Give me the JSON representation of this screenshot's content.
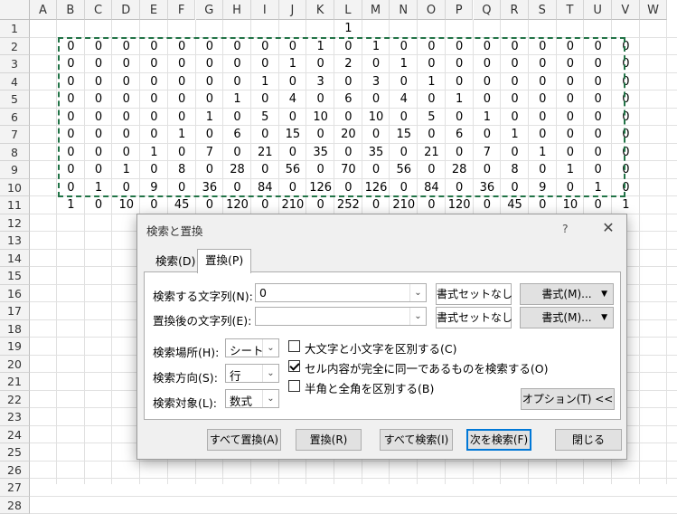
{
  "columns": [
    "A",
    "B",
    "C",
    "D",
    "E",
    "F",
    "G",
    "H",
    "I",
    "J",
    "K",
    "L",
    "M",
    "N",
    "O",
    "P",
    "Q",
    "R",
    "S",
    "T",
    "U",
    "V",
    "W"
  ],
  "rows": [
    "1",
    "2",
    "3",
    "4",
    "5",
    "6",
    "7",
    "8",
    "9",
    "10",
    "11",
    "12",
    "13",
    "14",
    "15",
    "16",
    "17",
    "18",
    "19",
    "20",
    "21",
    "22",
    "23",
    "24",
    "25",
    "26",
    "27",
    "28"
  ],
  "cells": {
    "row1": {
      "L": "1"
    },
    "data_columns": [
      "B",
      "C",
      "D",
      "E",
      "F",
      "G",
      "H",
      "I",
      "J",
      "K",
      "L",
      "M",
      "N",
      "O",
      "P",
      "Q",
      "R",
      "S",
      "T",
      "U",
      "V"
    ],
    "data_rows": [
      [
        "0",
        "0",
        "0",
        "0",
        "0",
        "0",
        "0",
        "0",
        "0",
        "1",
        "0",
        "1",
        "0",
        "0",
        "0",
        "0",
        "0",
        "0",
        "0",
        "0",
        "0"
      ],
      [
        "0",
        "0",
        "0",
        "0",
        "0",
        "0",
        "0",
        "0",
        "1",
        "0",
        "2",
        "0",
        "1",
        "0",
        "0",
        "0",
        "0",
        "0",
        "0",
        "0",
        "0"
      ],
      [
        "0",
        "0",
        "0",
        "0",
        "0",
        "0",
        "0",
        "1",
        "0",
        "3",
        "0",
        "3",
        "0",
        "1",
        "0",
        "0",
        "0",
        "0",
        "0",
        "0",
        "0"
      ],
      [
        "0",
        "0",
        "0",
        "0",
        "0",
        "0",
        "1",
        "0",
        "4",
        "0",
        "6",
        "0",
        "4",
        "0",
        "1",
        "0",
        "0",
        "0",
        "0",
        "0",
        "0"
      ],
      [
        "0",
        "0",
        "0",
        "0",
        "0",
        "1",
        "0",
        "5",
        "0",
        "10",
        "0",
        "10",
        "0",
        "5",
        "0",
        "1",
        "0",
        "0",
        "0",
        "0",
        "0"
      ],
      [
        "0",
        "0",
        "0",
        "0",
        "1",
        "0",
        "6",
        "0",
        "15",
        "0",
        "20",
        "0",
        "15",
        "0",
        "6",
        "0",
        "1",
        "0",
        "0",
        "0",
        "0"
      ],
      [
        "0",
        "0",
        "0",
        "1",
        "0",
        "7",
        "0",
        "21",
        "0",
        "35",
        "0",
        "35",
        "0",
        "21",
        "0",
        "7",
        "0",
        "1",
        "0",
        "0",
        "0"
      ],
      [
        "0",
        "0",
        "1",
        "0",
        "8",
        "0",
        "28",
        "0",
        "56",
        "0",
        "70",
        "0",
        "56",
        "0",
        "28",
        "0",
        "8",
        "0",
        "1",
        "0",
        "0"
      ],
      [
        "0",
        "1",
        "0",
        "9",
        "0",
        "36",
        "0",
        "84",
        "0",
        "126",
        "0",
        "126",
        "0",
        "84",
        "0",
        "36",
        "0",
        "9",
        "0",
        "1",
        "0"
      ],
      [
        "1",
        "0",
        "10",
        "0",
        "45",
        "0",
        "120",
        "0",
        "210",
        "0",
        "252",
        "0",
        "210",
        "0",
        "120",
        "0",
        "45",
        "0",
        "10",
        "0",
        "1"
      ]
    ]
  },
  "dialog": {
    "title": "検索と置換",
    "help": "?",
    "close": "✕",
    "tabs": {
      "search": "検索(D)",
      "replace": "置換(P)"
    },
    "find_label": "検索する文字列(N):",
    "find_value": "0",
    "replace_label": "置換後の文字列(E):",
    "replace_value": "",
    "no_format_1": "書式セットなし",
    "no_format_2": "書式セットなし",
    "format_1": "書式(M)...",
    "format_2": "書式(M)...",
    "within_label": "検索場所(H):",
    "within_value": "シート",
    "direction_label": "検索方向(S):",
    "direction_value": "行",
    "lookin_label": "検索対象(L):",
    "lookin_value": "数式",
    "opt_case": "大文字と小文字を区別する(C)",
    "opt_case_checked": false,
    "opt_entire": "セル内容が完全に同一であるものを検索する(O)",
    "opt_entire_checked": true,
    "opt_width": "半角と全角を区別する(B)",
    "opt_width_checked": false,
    "options_btn": "オプション(T) <<",
    "replace_all": "すべて置換(A)",
    "replace": "置換(R)",
    "find_all": "すべて検索(I)",
    "find_next": "次を検索(F)",
    "close_btn": "閉じる"
  }
}
